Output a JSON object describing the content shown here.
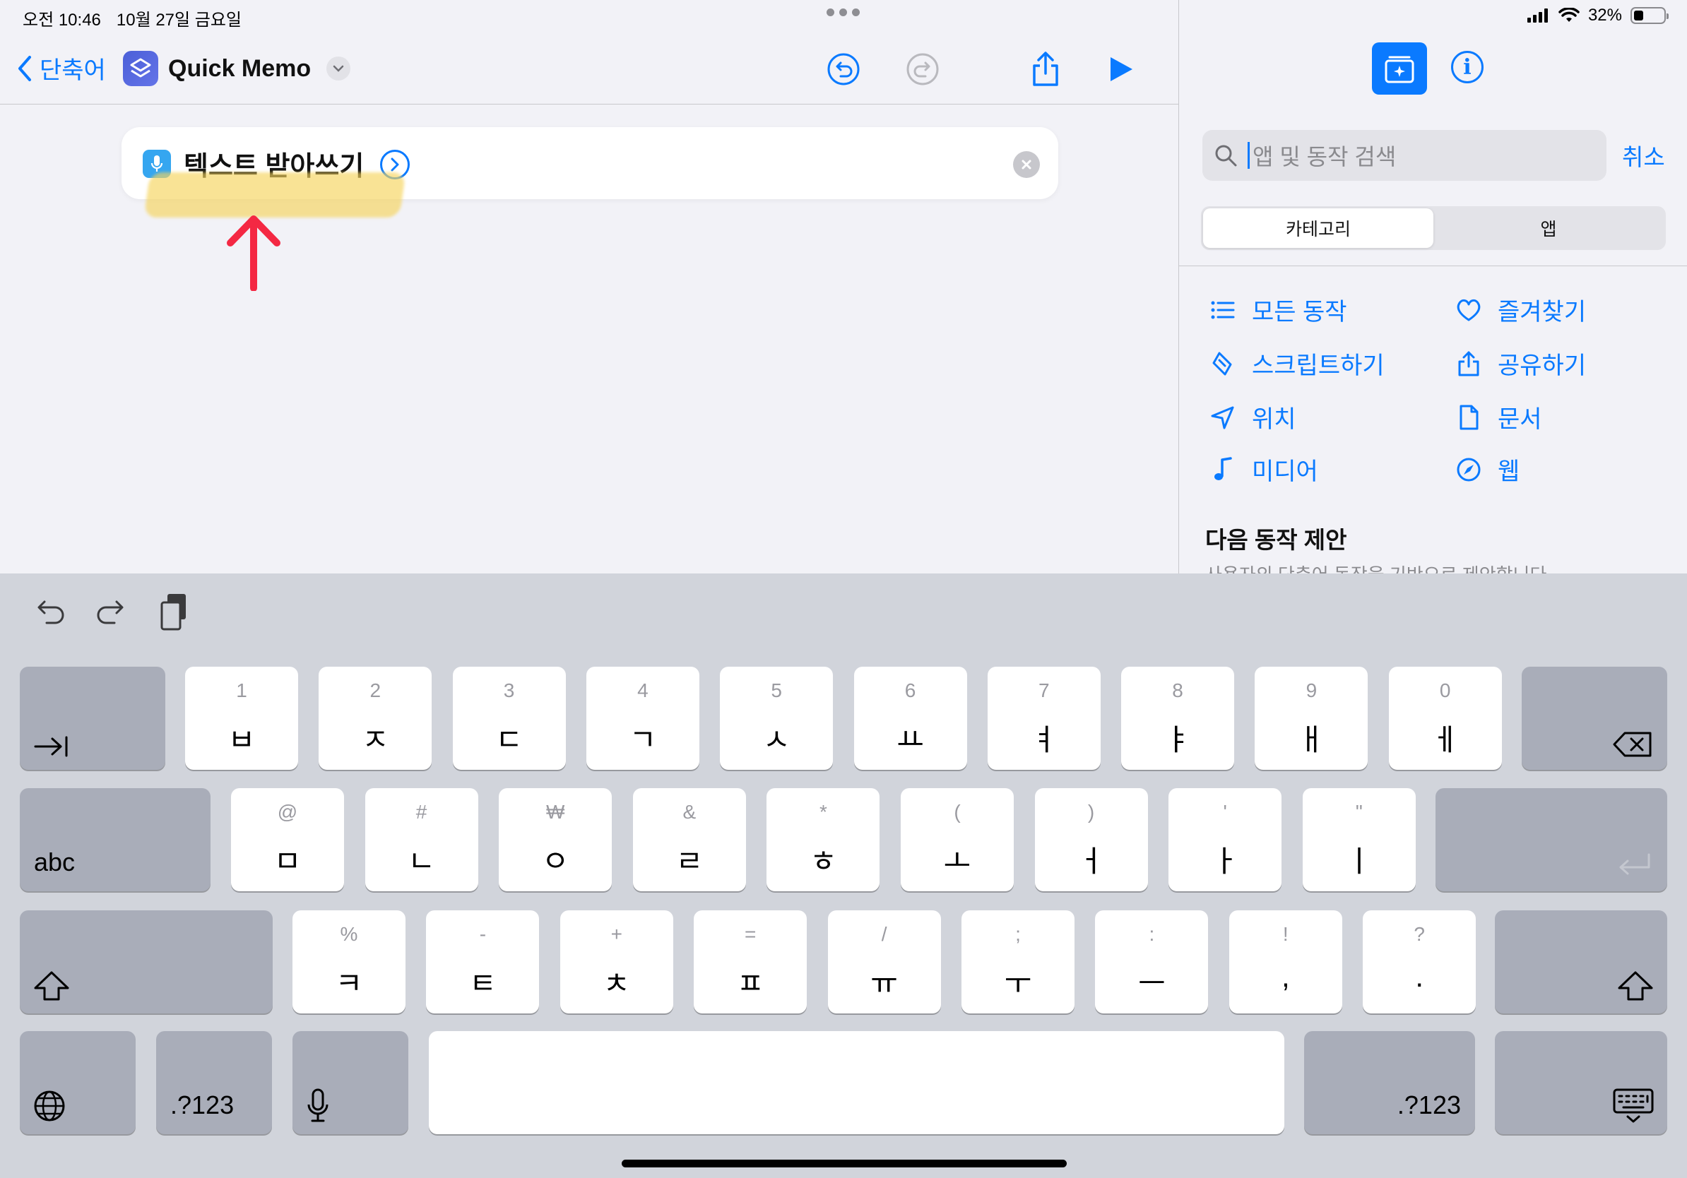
{
  "status_bar": {
    "time": "오전 10:46",
    "date": "10월 27일 금요일",
    "battery": "32%",
    "battery_level": 0.32
  },
  "nav": {
    "back_label": "단축어",
    "shortcut_name": "Quick Memo"
  },
  "action": {
    "label": "텍스트 받아쓰기"
  },
  "sidebar": {
    "search_placeholder": "앱 및 동작 검색",
    "cancel_label": "취소",
    "segments": [
      {
        "label": "카테고리",
        "active": true
      },
      {
        "label": "앱",
        "active": false
      }
    ],
    "categories": [
      {
        "label": "모든 동작",
        "icon": "list-icon"
      },
      {
        "label": "즐겨찾기",
        "icon": "heart-icon"
      },
      {
        "label": "스크립트하기",
        "icon": "script-icon"
      },
      {
        "label": "공유하기",
        "icon": "share-icon"
      },
      {
        "label": "위치",
        "icon": "location-icon"
      },
      {
        "label": "문서",
        "icon": "document-icon"
      },
      {
        "label": "미디어",
        "icon": "music-note-icon"
      },
      {
        "label": "웹",
        "icon": "compass-icon"
      }
    ],
    "suggestions_title": "다음 동작 제안",
    "suggestions_subtitle": "사용자의 단축어 동작을 기반으로 제안합니다"
  },
  "keyboard": {
    "row1": [
      {
        "top": "1",
        "main": "ㅂ"
      },
      {
        "top": "2",
        "main": "ㅈ"
      },
      {
        "top": "3",
        "main": "ㄷ"
      },
      {
        "top": "4",
        "main": "ㄱ"
      },
      {
        "top": "5",
        "main": "ㅅ"
      },
      {
        "top": "6",
        "main": "ㅛ"
      },
      {
        "top": "7",
        "main": "ㅕ"
      },
      {
        "top": "8",
        "main": "ㅑ"
      },
      {
        "top": "9",
        "main": "ㅐ"
      },
      {
        "top": "0",
        "main": "ㅔ"
      }
    ],
    "row2": [
      {
        "top": "@",
        "main": "ㅁ"
      },
      {
        "top": "#",
        "main": "ㄴ"
      },
      {
        "top": "₩",
        "main": "ㅇ"
      },
      {
        "top": "&",
        "main": "ㄹ"
      },
      {
        "top": "*",
        "main": "ㅎ"
      },
      {
        "top": "(",
        "main": "ㅗ"
      },
      {
        "top": ")",
        "main": "ㅓ"
      },
      {
        "top": "'",
        "main": "ㅏ"
      },
      {
        "top": "\"",
        "main": "ㅣ"
      }
    ],
    "row3": [
      {
        "top": "%",
        "main": "ㅋ"
      },
      {
        "top": "-",
        "main": "ㅌ"
      },
      {
        "top": "+",
        "main": "ㅊ"
      },
      {
        "top": "=",
        "main": "ㅍ"
      },
      {
        "top": "/",
        "main": "ㅠ"
      },
      {
        "top": ";",
        "main": "ㅜ"
      },
      {
        "top": ":",
        "main": "ㅡ"
      },
      {
        "top": "!",
        "main": ","
      },
      {
        "top": "?",
        "main": "."
      }
    ],
    "abc_label": "abc",
    "numbers_label": ".?123"
  }
}
